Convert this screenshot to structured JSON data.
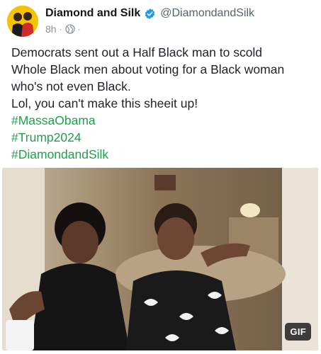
{
  "post": {
    "author": {
      "display_name": "Diamond and Silk",
      "handle": "@DiamondandSilk",
      "verified_icon": "verified-badge-icon",
      "avatar_bg": "#f5c400"
    },
    "meta": {
      "time": "8h",
      "separator": "·",
      "audience_icon": "globe-icon",
      "more": "·"
    },
    "text_lines": [
      "Democrats sent out a Half Black man to scold",
      "Whole Black men about voting for a Black woman",
      "who's not even Black.",
      "Lol, you can't make this sheeit up!"
    ],
    "hashtags": [
      "#MassaObama",
      "#Trump2024",
      "#DiamondandSilk"
    ],
    "media": {
      "badge": "GIF"
    }
  },
  "colors": {
    "hashtag": "#1da14a",
    "verified": "#1d9bf0",
    "meta": "#8a9197"
  }
}
